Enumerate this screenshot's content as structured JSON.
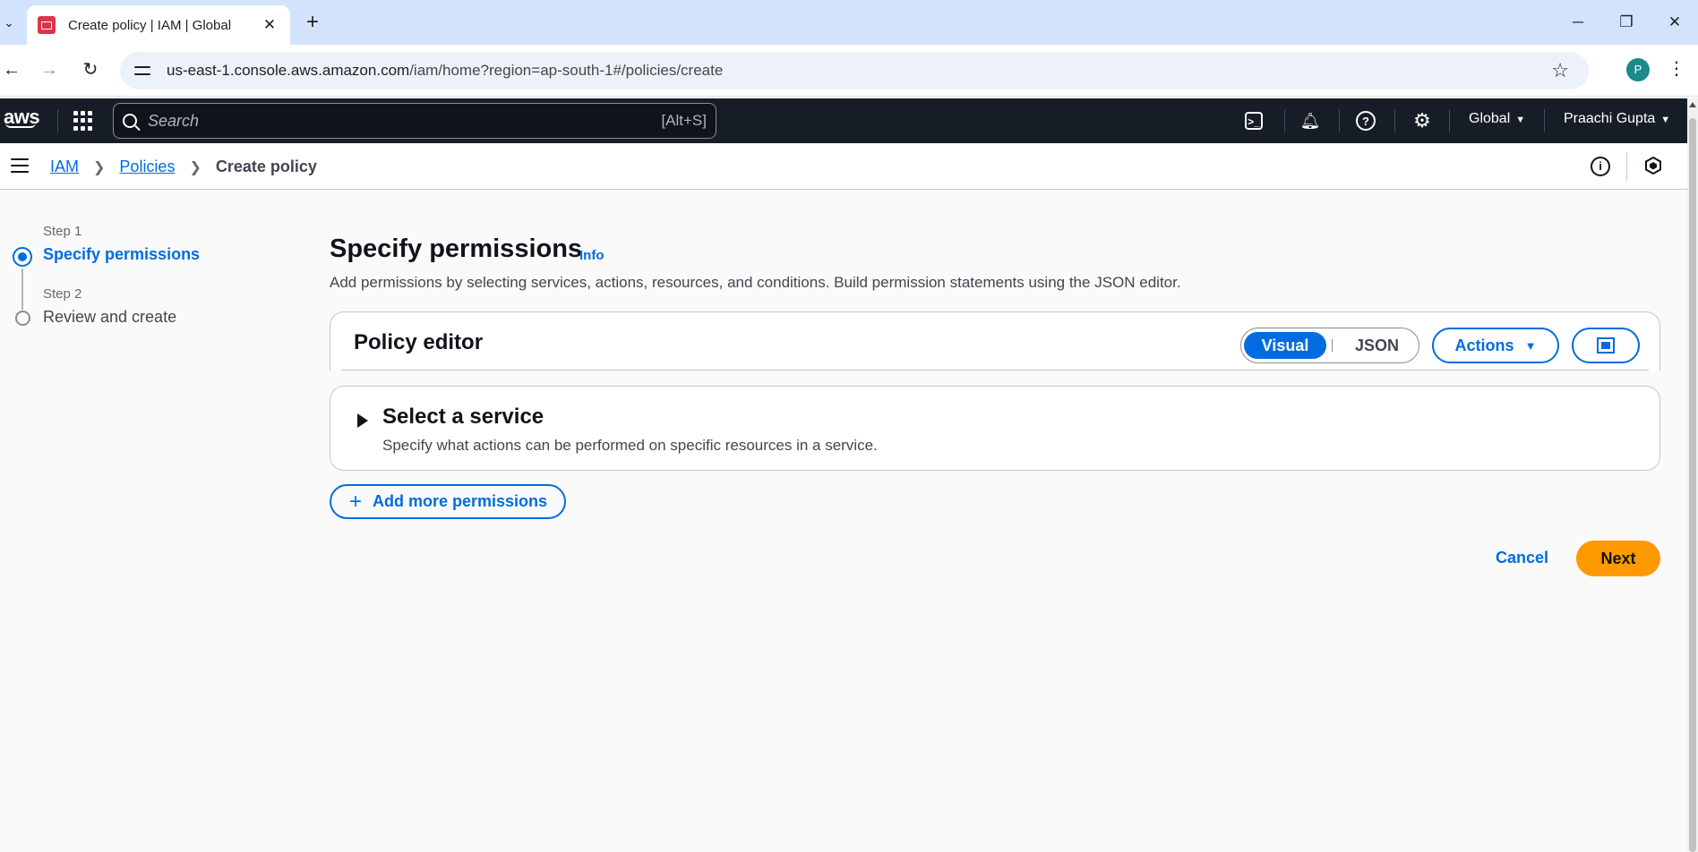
{
  "browser": {
    "tab_title": "Create policy | IAM | Global",
    "new_tab": "+",
    "url_host": "us-east-1.console.aws.amazon.com",
    "url_path": "/iam/home?region=ap-south-1#/policies/create",
    "profile_initial": "P"
  },
  "aws_header": {
    "logo": "aws",
    "search_placeholder": "Search",
    "search_shortcut": "[Alt+S]",
    "region": "Global",
    "user": "Praachi Gupta"
  },
  "breadcrumb": {
    "items": [
      "IAM",
      "Policies"
    ],
    "current": "Create policy"
  },
  "steps": [
    {
      "small": "Step 1",
      "label": "Specify permissions",
      "active": true
    },
    {
      "small": "Step 2",
      "label": "Review and create",
      "active": false
    }
  ],
  "main": {
    "title": "Specify permissions",
    "info_link": "Info",
    "description": "Add permissions by selecting services, actions, resources, and conditions. Build permission statements using the JSON editor.",
    "editor": {
      "title": "Policy editor",
      "toggle_options": [
        "Visual",
        "JSON"
      ],
      "selected": "Visual",
      "actions_label": "Actions"
    },
    "service": {
      "title": "Select a service",
      "description": "Specify what actions can be performed on specific resources in a service."
    },
    "add_permissions": "Add more permissions",
    "cancel": "Cancel",
    "next": "Next"
  },
  "colors": {
    "accent": "#006ce0",
    "primary_button": "#ff9900",
    "header_bg": "#161d26",
    "favicon": "#dd344c"
  }
}
